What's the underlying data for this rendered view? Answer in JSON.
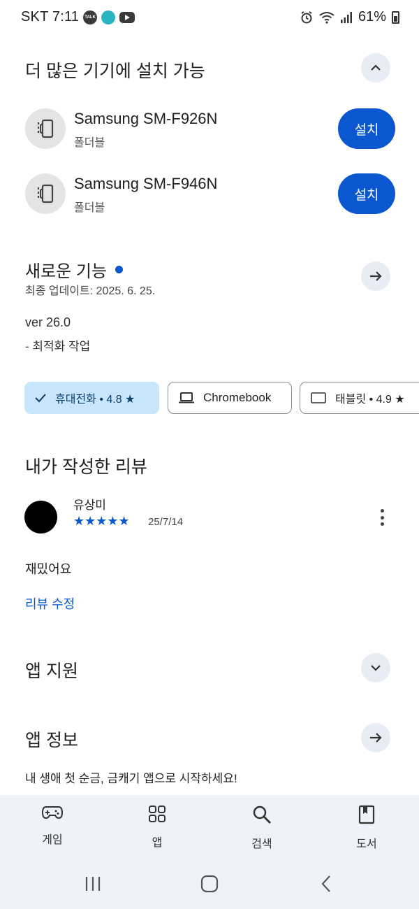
{
  "status_bar": {
    "carrier_time": "SKT 7:11",
    "talk_badge": "TALK",
    "battery": "61%",
    "icons": [
      "kakaotalk-icon",
      "game-app-icon",
      "youtube-icon",
      "alarm-icon",
      "wifi-icon",
      "signal-icon",
      "battery-icon"
    ]
  },
  "install_section": {
    "title": "더 많은 기기에 설치 가능",
    "devices": [
      {
        "name": "Samsung SM-F926N",
        "type": "폴더블",
        "button": "설치"
      },
      {
        "name": "Samsung SM-F946N",
        "type": "폴더블",
        "button": "설치"
      }
    ]
  },
  "whats_new": {
    "title": "새로운 기능",
    "updated": "최종 업데이트: 2025. 6. 25.",
    "version": "ver 26.0",
    "notes": "- 최적화 작업"
  },
  "device_chips": [
    {
      "label": "휴대전화 • 4.8 ★",
      "selected": true
    },
    {
      "label": "Chromebook",
      "selected": false
    },
    {
      "label": "태블릿 • 4.9 ★",
      "selected": false
    }
  ],
  "my_review": {
    "title": "내가 작성한 리뷰",
    "author": "유상미",
    "stars": "★★★★★",
    "rating": 5,
    "date": "25/7/14",
    "text": "재밌어요",
    "edit_link": "리뷰 수정"
  },
  "app_support": {
    "title": "앱 지원"
  },
  "app_info": {
    "title": "앱 정보",
    "description": "내 생애 첫 순금, 금캐기 앱으로 시작하세요!"
  },
  "bottom_nav": [
    {
      "label": "게임",
      "icon": "gamepad-icon"
    },
    {
      "label": "앱",
      "icon": "apps-grid-icon"
    },
    {
      "label": "검색",
      "icon": "search-icon"
    },
    {
      "label": "도서",
      "icon": "book-icon"
    }
  ],
  "colors": {
    "accent": "#0b57d0",
    "chip_selected_bg": "#c7e6fb",
    "circle_button_bg": "#e8ecf5",
    "nav_bg": "#eef2fa"
  }
}
